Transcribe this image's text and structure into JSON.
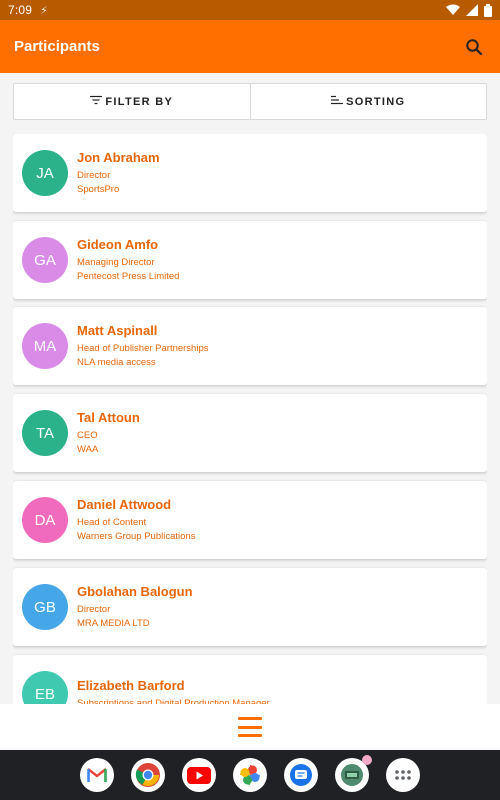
{
  "status_bar": {
    "time": "7:09",
    "charging_glyph": "⚡"
  },
  "app_bar": {
    "title": "Participants",
    "search_icon": "search-icon"
  },
  "toolbar": {
    "filter_label": "FILTER BY",
    "sorting_label": "SORTING"
  },
  "participants": [
    {
      "initials": "JA",
      "name": "Jon Abraham",
      "role": "Director",
      "organization": "SportsPro",
      "avatar_color": "#2bb28a"
    },
    {
      "initials": "GA",
      "name": "Gideon Amfo",
      "role": "Managing Director",
      "organization": "Pentecost Press Limited",
      "avatar_color": "#d98be8"
    },
    {
      "initials": "MA",
      "name": "Matt Aspinall",
      "role": "Head of Publisher Partnerships",
      "organization": "NLA media access",
      "avatar_color": "#d98be8"
    },
    {
      "initials": "TA",
      "name": "Tal Attoun",
      "role": "CEO",
      "organization": "WAA",
      "avatar_color": "#2bb28a"
    },
    {
      "initials": "DA",
      "name": "Daniel Attwood",
      "role": "Head of Content",
      "organization": "Warners Group Publications",
      "avatar_color": "#f06bbd"
    },
    {
      "initials": "GB",
      "name": "Gbolahan Balogun",
      "role": "Director",
      "organization": "MRA MEDIA LTD",
      "avatar_color": "#45a6e8"
    },
    {
      "initials": "EB",
      "name": "Elizabeth Barford",
      "role": "Subscriptions and Digital Production Manager",
      "organization": "",
      "avatar_color": "#3fc9b0"
    }
  ],
  "dock_apps": [
    "gmail-icon",
    "chrome-icon",
    "youtube-icon",
    "photos-icon",
    "messages-icon",
    "app-icon",
    "app-drawer-icon"
  ],
  "colors": {
    "accent": "#ff6f00",
    "status_bar": "#b85a00",
    "text_accent": "#e8660a"
  }
}
